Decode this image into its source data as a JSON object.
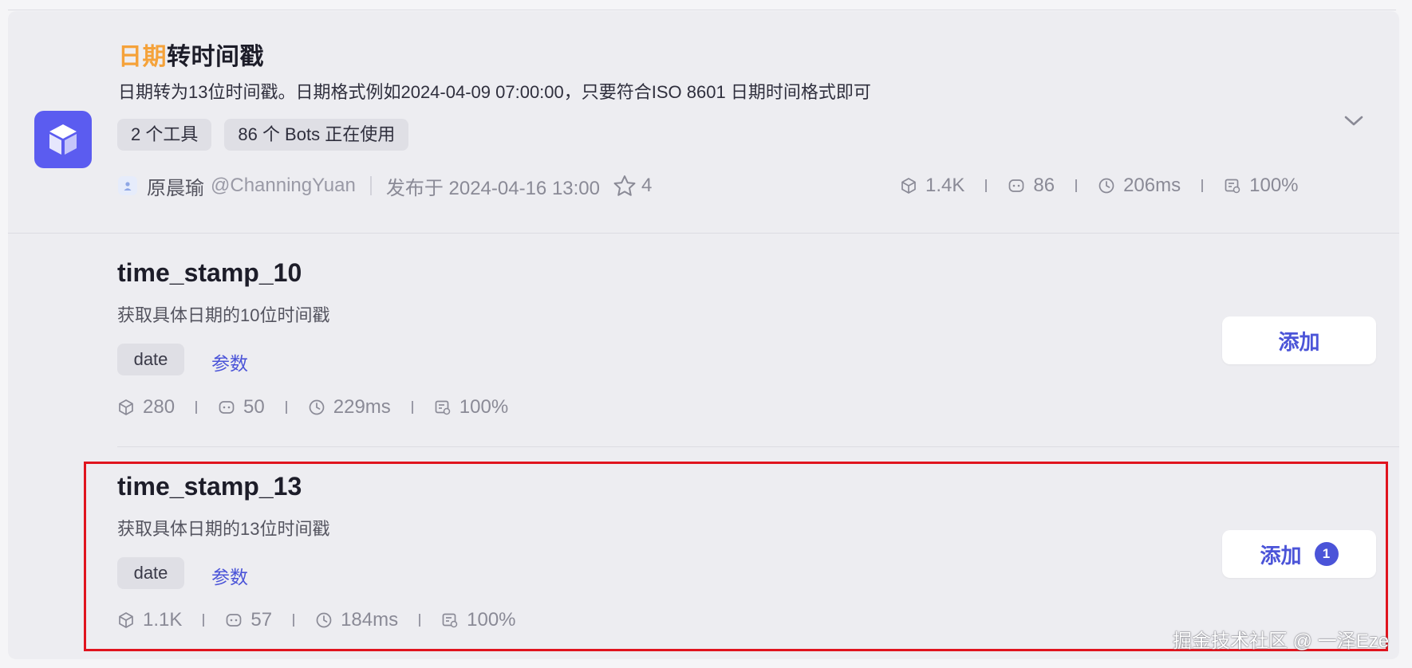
{
  "plugin": {
    "title_highlight": "日期",
    "title_rest": "转时间戳",
    "description": "日期转为13位时间戳。日期格式例如2024-04-09 07:00:00，只要符合ISO 8601 日期时间格式即可",
    "tags": [
      "2 个工具",
      "86 个 Bots 正在使用"
    ],
    "author": "原晨瑜",
    "handle": "@ChanningYuan",
    "published": "发布于 2024-04-16 13:00",
    "stars": "4",
    "stats": {
      "calls": "1.4K",
      "bots": "86",
      "latency": "206ms",
      "success": "100%"
    },
    "icon": "cube-icon",
    "accent_color": "#5b5cf0",
    "highlight_color": "#f5a23a"
  },
  "tools": [
    {
      "name": "time_stamp_10",
      "description": "获取具体日期的10位时间戳",
      "param_tag": "date",
      "param_link": "参数",
      "stats": {
        "calls": "280",
        "bots": "50",
        "latency": "229ms",
        "success": "100%"
      },
      "add_label": "添加",
      "badge": ""
    },
    {
      "name": "time_stamp_13",
      "description": "获取具体日期的13位时间戳",
      "param_tag": "date",
      "param_link": "参数",
      "stats": {
        "calls": "1.1K",
        "bots": "57",
        "latency": "184ms",
        "success": "100%"
      },
      "add_label": "添加",
      "badge": "1"
    }
  ],
  "watermark": "掘金技术社区 @ 一泽Eze",
  "colors": {
    "link": "#4b54d8",
    "highlight_border": "#e0141e"
  }
}
